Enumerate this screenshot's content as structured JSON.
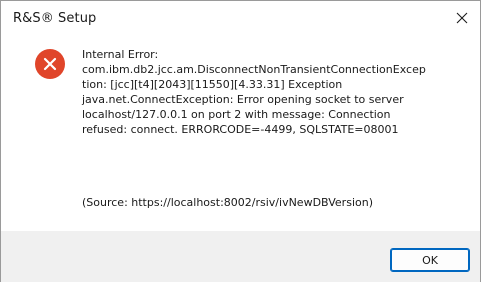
{
  "window": {
    "title": "R&S® Setup",
    "close_icon": "close-icon"
  },
  "message": {
    "icon": "error-icon",
    "lines": [
      "Internal Error:",
      "com.ibm.db2.jcc.am.DisconnectNonTransientConnectionExcep",
      "tion: [jcc][t4][2043][11550][4.33.31] Exception",
      "java.net.ConnectException: Error opening socket to server",
      "localhost/127.0.0.1 on port 2 with message: Connection",
      "refused: connect. ERRORCODE=-4499, SQLSTATE=08001"
    ],
    "source": "(Source: https://localhost:8002/rsiv/ivNewDBVersion)"
  },
  "buttons": {
    "ok_label": "OK"
  },
  "colors": {
    "error_red": "#e0452a",
    "footer_bg": "#f0f0f0",
    "accent_blue": "#0067c0"
  }
}
